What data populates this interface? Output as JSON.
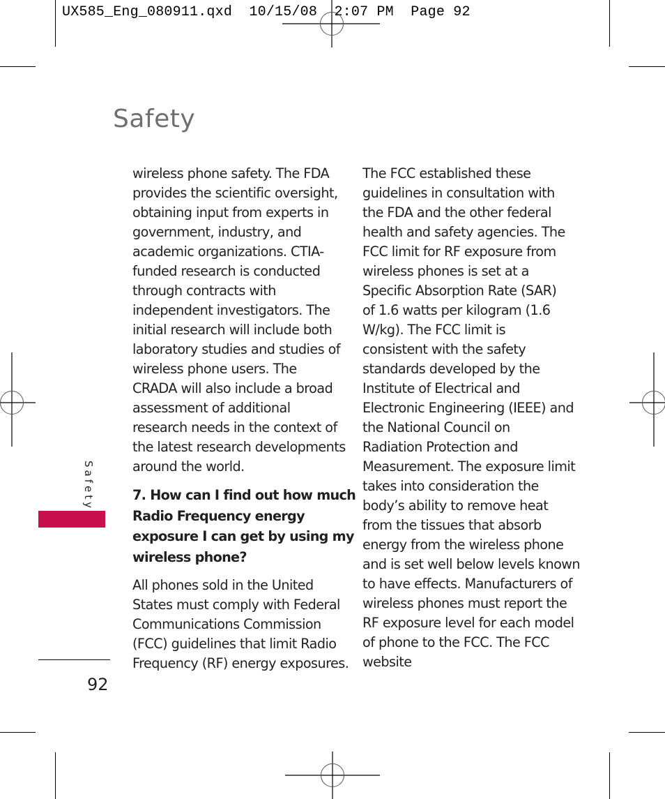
{
  "slug": {
    "text": "UX585_Eng_080911.qxd  10/15/08  2:07 PM  Page 92"
  },
  "header": {
    "title": "Safety"
  },
  "side_tab": {
    "label": "Safety",
    "accent_color": "#c8104f"
  },
  "page_number": "92",
  "column1": {
    "para1_lines": [
      "wireless phone safety. The FDA",
      "provides the scientific oversight,",
      "obtaining input from experts in",
      "government, industry, and",
      "academic organizations. CTIA-",
      "funded research is conducted",
      "through contracts with",
      "independent investigators. The",
      "initial research will include both",
      "laboratory studies and studies of",
      "wireless phone users. The",
      "CRADA will also include a broad",
      "assessment of additional",
      "research needs in the context of",
      "the latest research developments",
      "around the world."
    ],
    "question_lines": [
      "7. How can I find out how much",
      "Radio Frequency energy",
      "exposure I can get by using my",
      "wireless phone?"
    ],
    "para2_lines": [
      "All phones sold in the United",
      "States must comply with Federal",
      "Communications Commission",
      "(FCC) guidelines that limit Radio",
      "Frequency (RF) energy exposures."
    ]
  },
  "column2": {
    "para_lines": [
      "The FCC established these",
      "guidelines in consultation with",
      "the FDA and the other federal",
      "health and safety agencies. The",
      "FCC limit for RF exposure from",
      "wireless phones is set at a",
      "Specific Absorption Rate (SAR)",
      "of 1.6 watts per kilogram (1.6",
      "W/kg). The FCC limit is",
      "consistent with the safety",
      "standards developed by the",
      "Institute of Electrical and",
      "Electronic Engineering (IEEE) and",
      "the National Council on",
      "Radiation Protection and",
      "Measurement. The exposure limit",
      "takes into consideration the",
      "body’s ability to remove heat",
      "from the tissues that absorb",
      "energy from the wireless phone",
      "and is set well below levels known",
      "to have effects. Manufacturers of",
      "wireless phones must report the",
      "RF exposure level for each model",
      "of phone to the FCC. The FCC",
      "website"
    ]
  }
}
